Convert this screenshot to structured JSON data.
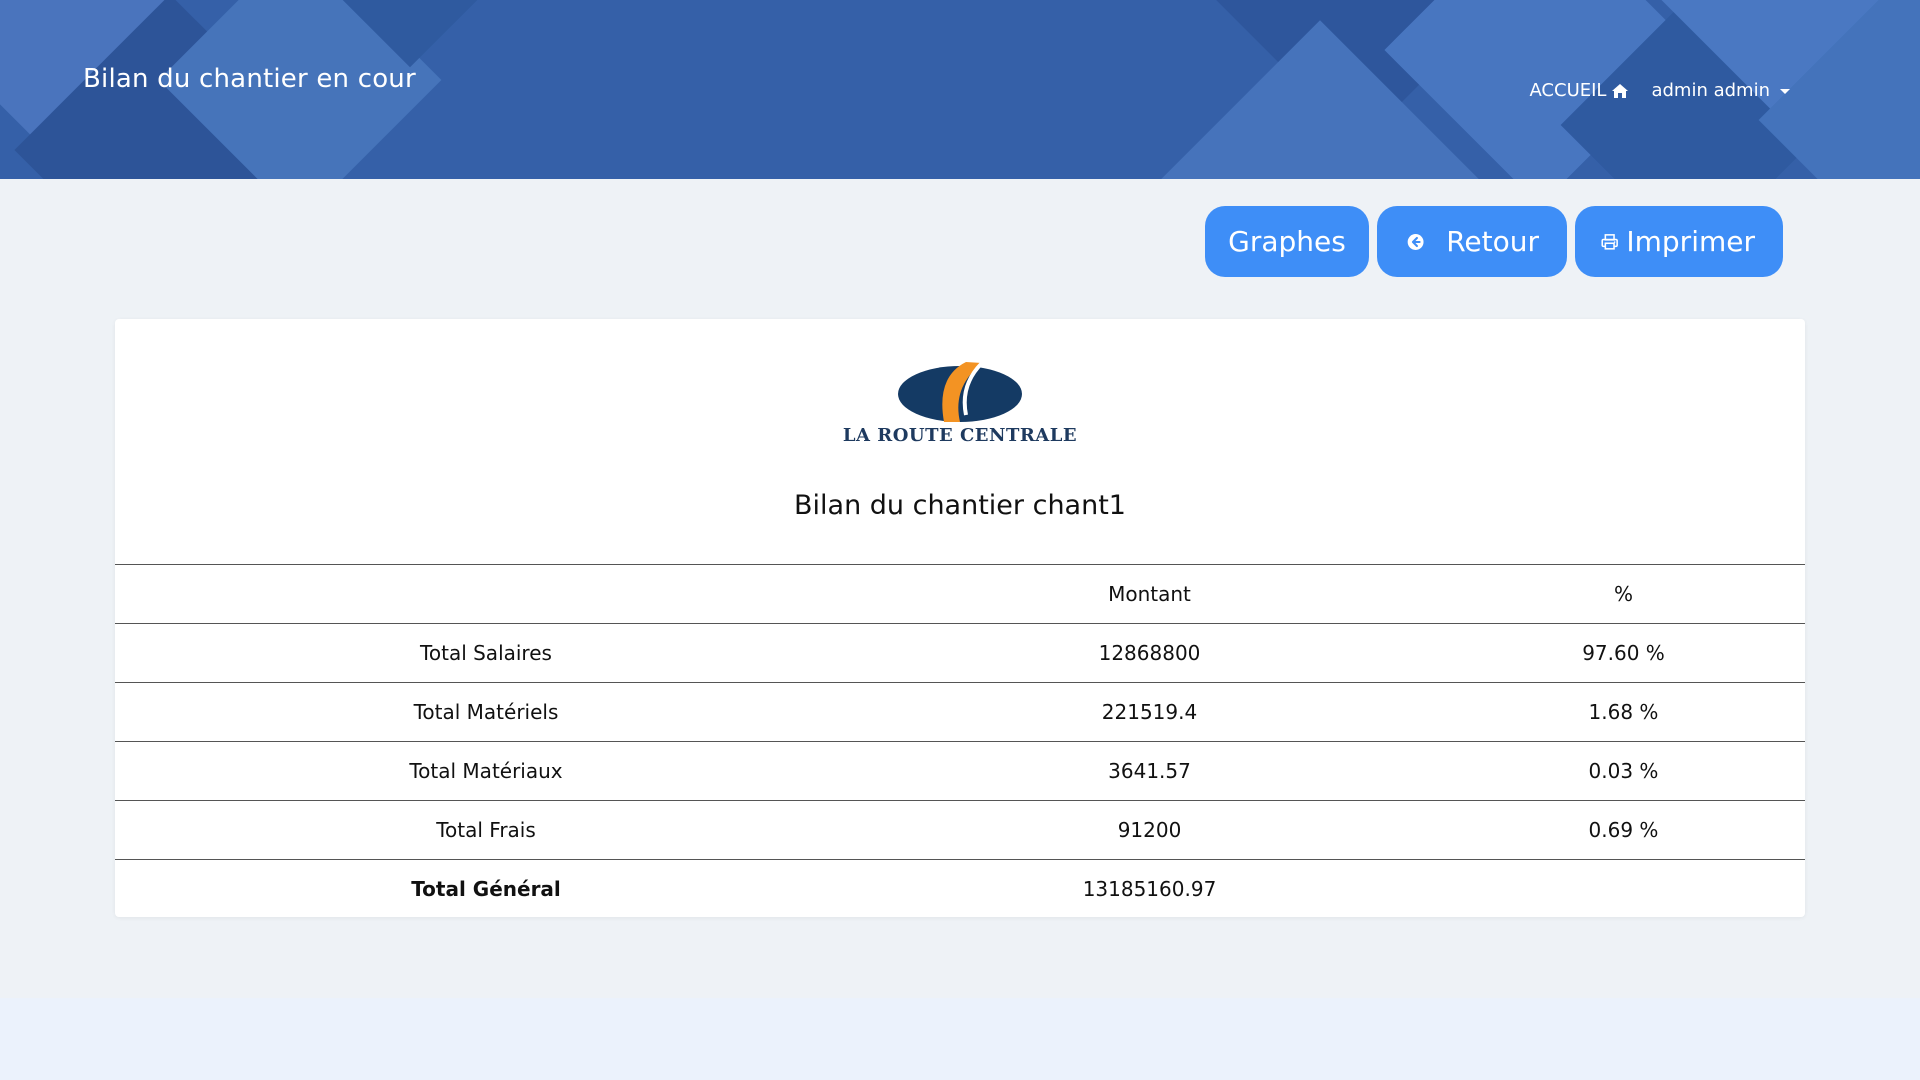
{
  "header": {
    "title": "Bilan du chantier en cour",
    "nav": {
      "home_label": "ACCUEIL",
      "user_label": "admin admin"
    }
  },
  "toolbar": {
    "graphes_label": "Graphes",
    "retour_label": "Retour",
    "imprimer_label": "Imprimer"
  },
  "logo": {
    "text": "LA ROUTE CENTRALE"
  },
  "report": {
    "title": "Bilan du chantier chant1",
    "columns": [
      "",
      "Montant",
      "%"
    ],
    "rows": [
      {
        "label": "Total Salaires",
        "montant": "12868800",
        "pct": "97.60 %"
      },
      {
        "label": "Total Matériels",
        "montant": "221519.4",
        "pct": "1.68 %"
      },
      {
        "label": "Total Matériaux",
        "montant": "3641.57",
        "pct": "0.03 %"
      },
      {
        "label": "Total Frais",
        "montant": "91200",
        "pct": "0.69 %"
      }
    ],
    "total": {
      "label": "Total Général",
      "montant": "13185160.97",
      "pct": ""
    }
  },
  "colors": {
    "header_bg": "#3560a8",
    "button_bg": "#3e8ef7",
    "logo_navy": "#143a64",
    "logo_orange": "#f39323"
  }
}
